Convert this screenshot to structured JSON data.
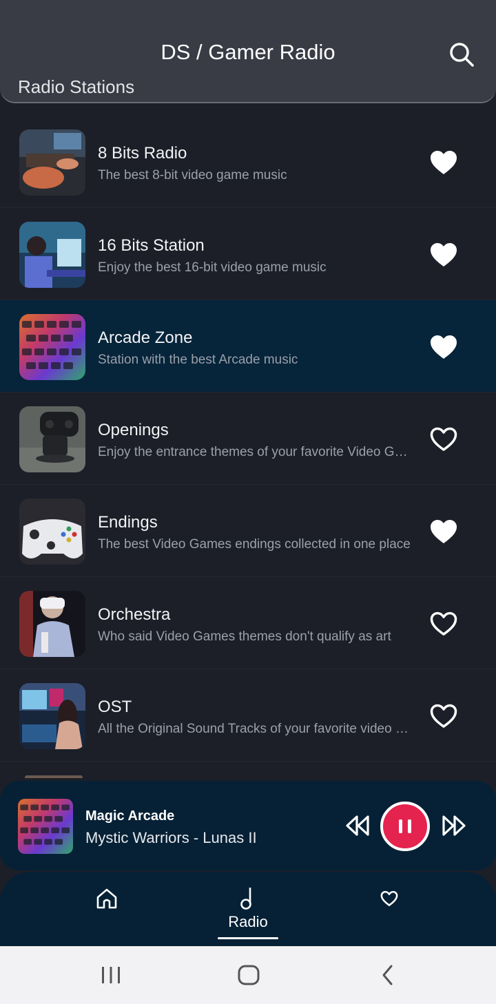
{
  "header": {
    "title": "DS / Gamer Radio",
    "subtitle": "Radio Stations",
    "search_icon": "search-icon"
  },
  "colors": {
    "background": "#1c1f28",
    "header": "#393c45",
    "selected_row": "#06243a",
    "player": "#062136",
    "accent": "#e5234f"
  },
  "stations": [
    {
      "name": "8 Bits Radio",
      "description": "The best 8-bit video game music",
      "favorite": true,
      "selected": false,
      "thumb": "gaming-keyboard-hands-photo"
    },
    {
      "name": "16 Bits Station",
      "description": "Enjoy the best 16-bit video game music",
      "favorite": true,
      "selected": false,
      "thumb": "gamer-headset-photo"
    },
    {
      "name": "Arcade Zone",
      "description": "Station with the best Arcade music",
      "favorite": true,
      "selected": true,
      "thumb": "rgb-keyboard-photo"
    },
    {
      "name": "Openings",
      "description": "Enjoy the entrance themes of your favorite Video Games",
      "favorite": false,
      "selected": false,
      "thumb": "gamepad-photo"
    },
    {
      "name": "Endings",
      "description": "The best Video Games endings collected in one place",
      "favorite": true,
      "selected": false,
      "thumb": "white-controller-photo"
    },
    {
      "name": "Orchestra",
      "description": "Who said Video Games themes don't qualify as art",
      "favorite": false,
      "selected": false,
      "thumb": "vr-headset-photo"
    },
    {
      "name": "OST",
      "description": "All the Original Sound Tracks of your favorite video games",
      "favorite": false,
      "selected": false,
      "thumb": "streamer-setup-photo"
    }
  ],
  "player": {
    "station": "Magic Arcade",
    "track": "Mystic Warriors - Lunas II",
    "rewind_icon": "rewind-icon",
    "pause_icon": "pause-icon",
    "forward_icon": "fast-forward-icon"
  },
  "nav": {
    "items": [
      {
        "icon": "home-icon",
        "label": ""
      },
      {
        "icon": "music-note-icon",
        "label": "Radio",
        "active": true
      },
      {
        "icon": "heart-icon",
        "label": ""
      }
    ]
  },
  "system_bar": {
    "buttons": [
      "recents-icon",
      "home-button-icon",
      "back-icon"
    ]
  }
}
